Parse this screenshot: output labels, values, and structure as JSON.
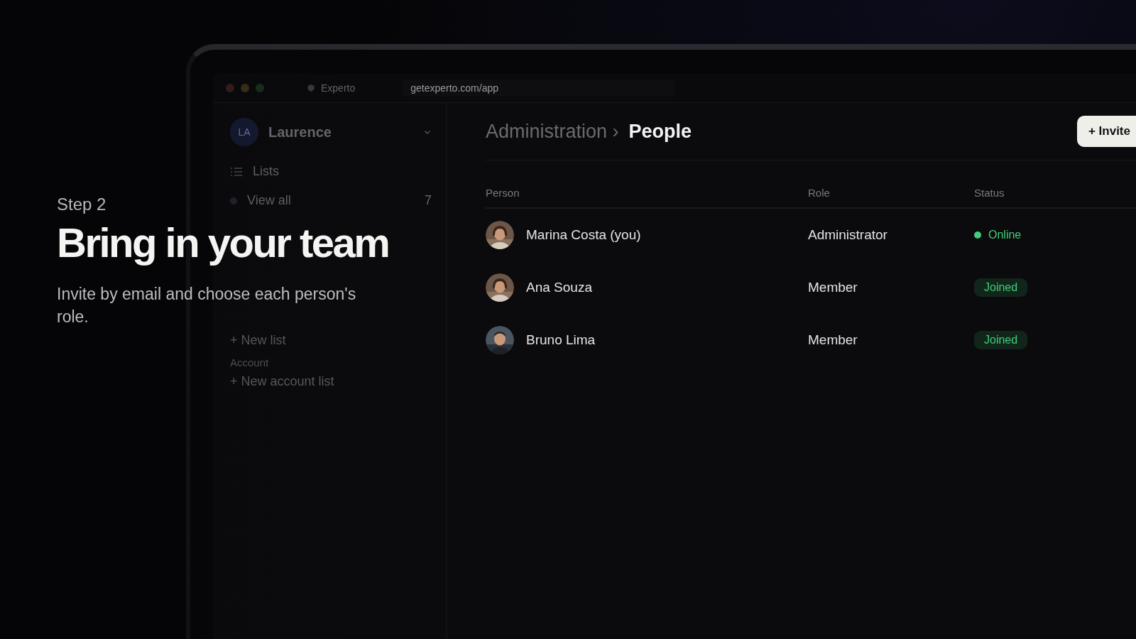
{
  "hero": {
    "step": "Step 2",
    "title": "Bring in your team",
    "subtitle": "Invite by email and choose each person's role."
  },
  "window": {
    "tab": "Experto",
    "url": "getexperto.com/app"
  },
  "sidebar": {
    "account": {
      "initials": "LA",
      "name": "Laurence"
    },
    "section": "Lists",
    "items": [
      {
        "label": "View all",
        "count": "7"
      }
    ],
    "new_list": "+ New list",
    "section_2": "Account",
    "new_account_list": "+ New account list"
  },
  "breadcrumb": {
    "parent": "Administration ›",
    "current": "People"
  },
  "invite_button": "+ Invite",
  "table": {
    "columns": [
      "Person",
      "Role",
      "Status"
    ],
    "rows": [
      {
        "name": "Marina Costa (you)",
        "role": "Administrator",
        "status": {
          "kind": "online",
          "label": "Online",
          "color": "#3ecf78"
        }
      },
      {
        "name": "Ana Souza",
        "role": "Member",
        "status": {
          "kind": "badge",
          "label": "Joined",
          "color": "#3ecf78"
        }
      },
      {
        "name": "Bruno Lima",
        "role": "Member",
        "status": {
          "kind": "badge",
          "label": "Joined",
          "color": "#3ecf78"
        }
      }
    ]
  }
}
